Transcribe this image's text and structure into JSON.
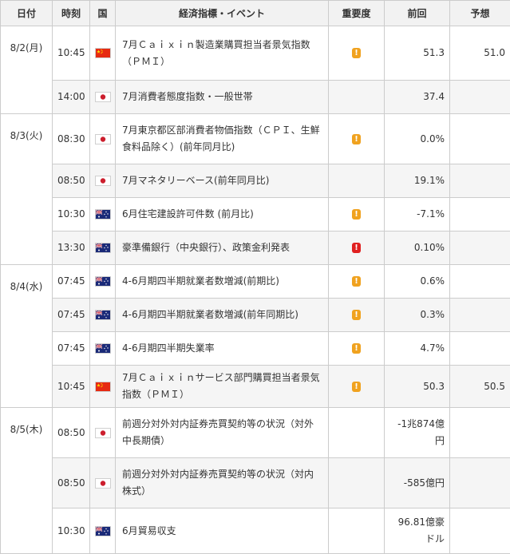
{
  "header": {
    "date": "日付",
    "time": "時刻",
    "country": "国",
    "event": "経済指標・イベント",
    "importance": "重要度",
    "previous": "前回",
    "forecast": "予想"
  },
  "colors": {
    "medium": "#f0a21f",
    "high": "#e02020",
    "japan_red": "#cc1e2d",
    "china_red": "#e62a12",
    "australia_blue": "#1a2a78"
  },
  "days": [
    {
      "date": "8/2(月)",
      "rows": [
        {
          "time": "10:45",
          "country": "china-flag-icon",
          "event": "7月Ｃａｉｘｉｎ製造業購買担当者景気指数（ＰＭＩ）",
          "importance": "medium",
          "importance_mark": "!",
          "previous": "51.3",
          "forecast": "51.0"
        },
        {
          "time": "14:00",
          "country": "japan-flag-icon",
          "event": "7月消費者態度指数・一般世帯",
          "importance": "",
          "importance_mark": "",
          "previous": "37.4",
          "forecast": ""
        }
      ]
    },
    {
      "date": "8/3(火)",
      "rows": [
        {
          "time": "08:30",
          "country": "japan-flag-icon",
          "event": "7月東京都区部消費者物価指数（ＣＰＩ、生鮮食料品除く）(前年同月比)",
          "importance": "medium",
          "importance_mark": "!",
          "previous": "0.0%",
          "forecast": ""
        },
        {
          "time": "08:50",
          "country": "japan-flag-icon",
          "event": "7月マネタリーベース(前年同月比)",
          "importance": "",
          "importance_mark": "",
          "previous": "19.1%",
          "forecast": ""
        },
        {
          "time": "10:30",
          "country": "australia-flag-icon",
          "event": "6月住宅建設許可件数 (前月比)",
          "importance": "medium",
          "importance_mark": "!",
          "previous": "-7.1%",
          "forecast": ""
        },
        {
          "time": "13:30",
          "country": "australia-flag-icon",
          "event": "豪準備銀行（中央銀行）、政策金利発表",
          "importance": "high",
          "importance_mark": "!",
          "previous": "0.10%",
          "forecast": ""
        }
      ]
    },
    {
      "date": "8/4(水)",
      "rows": [
        {
          "time": "07:45",
          "country": "australia-flag-icon",
          "event": "4-6月期四半期就業者数増減(前期比)",
          "importance": "medium",
          "importance_mark": "!",
          "previous": "0.6%",
          "forecast": ""
        },
        {
          "time": "07:45",
          "country": "australia-flag-icon",
          "event": "4-6月期四半期就業者数増減(前年同期比)",
          "importance": "medium",
          "importance_mark": "!",
          "previous": "0.3%",
          "forecast": ""
        },
        {
          "time": "07:45",
          "country": "australia-flag-icon",
          "event": "4-6月期四半期失業率",
          "importance": "medium",
          "importance_mark": "!",
          "previous": "4.7%",
          "forecast": ""
        },
        {
          "time": "10:45",
          "country": "china-flag-icon",
          "event": "7月Ｃａｉｘｉｎサービス部門購買担当者景気指数（ＰＭＩ）",
          "importance": "medium",
          "importance_mark": "!",
          "previous": "50.3",
          "forecast": "50.5"
        }
      ]
    },
    {
      "date": "8/5(木)",
      "rows": [
        {
          "time": "08:50",
          "country": "japan-flag-icon",
          "event": "前週分対外対内証券売買契約等の状況（対外中長期債）",
          "importance": "",
          "importance_mark": "",
          "previous": "-1兆874億円",
          "forecast": ""
        },
        {
          "time": "08:50",
          "country": "japan-flag-icon",
          "event": "前週分対外対内証券売買契約等の状況（対内株式）",
          "importance": "",
          "importance_mark": "",
          "previous": "-585億円",
          "forecast": ""
        },
        {
          "time": "10:30",
          "country": "australia-flag-icon",
          "event": "6月貿易収支",
          "importance": "",
          "importance_mark": "",
          "previous": "96.81億豪ドル",
          "forecast": ""
        }
      ]
    }
  ]
}
